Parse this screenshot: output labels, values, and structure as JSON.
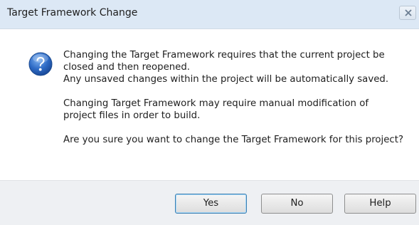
{
  "dialog": {
    "title": "Target Framework Change",
    "close_icon": "close-x-icon",
    "icon": "question-icon",
    "icon_color": "#2e6bc6",
    "message_lines": [
      "Changing the Target Framework requires that the current project be",
      "closed and then reopened.",
      "Any unsaved changes within the project will be automatically saved.",
      "",
      "Changing Target Framework may require manual modification of",
      "project files in order to build.",
      "",
      "Are you sure you want to change the Target Framework for this project?"
    ]
  },
  "buttons": {
    "yes": "Yes",
    "no": "No",
    "help": "Help"
  }
}
